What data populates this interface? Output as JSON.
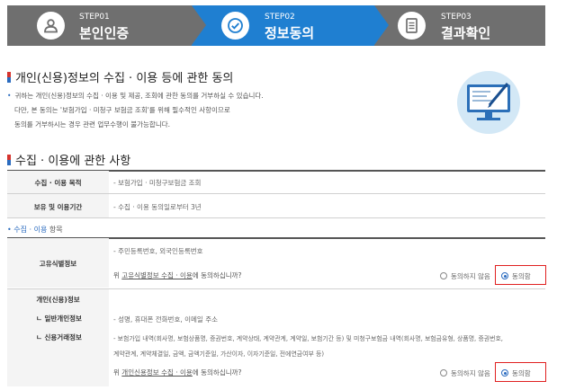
{
  "steps": [
    {
      "num": "STEP01",
      "name": "본인인증",
      "icon": "person-icon",
      "active": false
    },
    {
      "num": "STEP02",
      "name": "정보동의",
      "icon": "checkmark-icon",
      "active": true
    },
    {
      "num": "STEP03",
      "name": "결과확인",
      "icon": "document-icon",
      "active": false
    }
  ],
  "section1": {
    "title": "개인(신용)정보의 수집 · 이용 등에 관한 동의",
    "lines": [
      "귀하는 개인(신용)정보의 수집 · 이용 및 제공, 조회에 관한 동의를 거부하실 수 있습니다.",
      "다만, 본 동의는 '보험가입 · 미청구 보험금 조회'를 위해 필수적인 사항이므로",
      "동의를 거부하시는 경우 관련 업무수행이 불가능합니다."
    ]
  },
  "section2": {
    "title": "수집 · 이용에 관한 사항",
    "rows": [
      {
        "head": "수집 · 이용 목적",
        "value": "- 보험가입 · 미청구보험금 조회"
      },
      {
        "head": "보유 및 이용기간",
        "value": "- 수집 · 이용 동의일로부터 3년"
      }
    ]
  },
  "items": {
    "label": "수집 · 이용",
    "label_suffix": " 항목",
    "group1": {
      "head": "고유식별정보",
      "value": "- 주민등록번호, 외국인등록번호",
      "question_prefix": "위 ",
      "question_link": "고유식별정보 수집 · 이용",
      "question_suffix": "에 동의하십니까?",
      "disagree": "동의하지 않음",
      "agree": "동의함",
      "selected": "agree"
    },
    "group2": {
      "head": "개인(신용)정보",
      "sub1": "ㄴ 일반개인정보",
      "sub2": "ㄴ 신용거래정보",
      "value1": "- 성명, 휴대폰 전화번호, 이메일 주소",
      "value2_line1": "- 보험가입 내역(회사명, 보험상품명, 증권번호, 계약상태, 계약관계, 계약일, 보험기간 등) 및 미청구보험금 내역(회사명, 보험금유형, 상품명, 증권번호,",
      "value2_line2": "계약관계, 계약체결일, 금액, 금액기준일, 가산이자, 이자기준일, 전에연금여부 등)",
      "question_prefix": "위 ",
      "question_link": "개인신용정보 수집 · 이용",
      "question_suffix": "에 동의하십니까?",
      "disagree": "동의하지 않음",
      "agree": "동의함",
      "selected": "agree"
    }
  }
}
